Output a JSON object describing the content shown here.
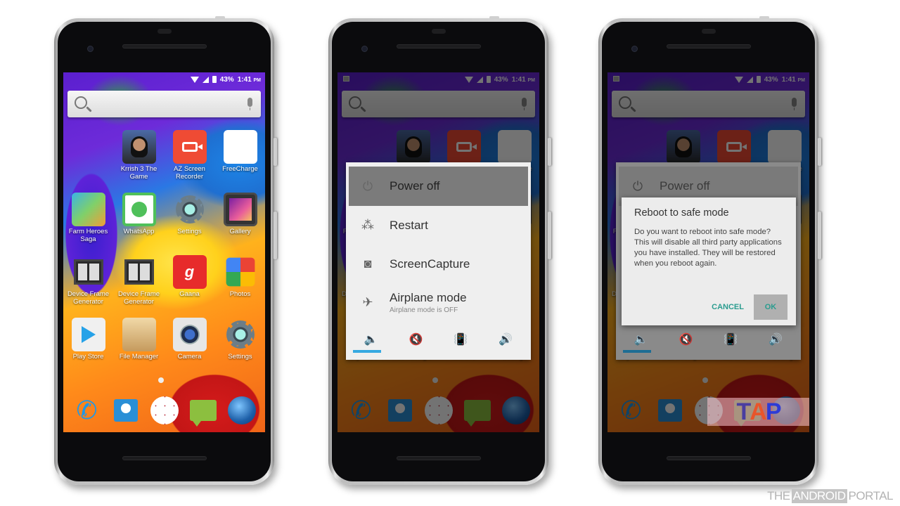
{
  "status_bar": {
    "battery": "43%",
    "time": "1:41",
    "ampm": "PM"
  },
  "search": {
    "icon": "search-icon",
    "mic_icon": "mic-icon"
  },
  "apps": [
    {
      "label": "",
      "icon": "empty"
    },
    {
      "label": "Krrish 3 The Game",
      "icon": "krrish-icon"
    },
    {
      "label": "AZ Screen Recorder",
      "icon": "video-camera-icon"
    },
    {
      "label": "FreeCharge",
      "icon": "lightning-icon"
    },
    {
      "label": "Farm Heroes Saga",
      "icon": "farm-heroes-icon"
    },
    {
      "label": "WhatsApp",
      "icon": "whatsapp-icon"
    },
    {
      "label": "Settings",
      "icon": "gear-icon"
    },
    {
      "label": "Gallery",
      "icon": "gallery-icon"
    },
    {
      "label": "Device Frame Generator",
      "icon": "device-frame-icon"
    },
    {
      "label": "Device Frame Generator",
      "icon": "device-frame-icon"
    },
    {
      "label": "Gaana",
      "icon": "gaana-icon",
      "glyph": "g"
    },
    {
      "label": "Photos",
      "icon": "pinwheel-icon"
    },
    {
      "label": "Play Store",
      "icon": "play-store-icon"
    },
    {
      "label": "File Manager",
      "icon": "file-manager-icon"
    },
    {
      "label": "Camera",
      "icon": "camera-icon"
    },
    {
      "label": "Settings",
      "icon": "gear-icon"
    }
  ],
  "dock": [
    {
      "name": "phone",
      "icon": "phone-icon",
      "glyph": "✆"
    },
    {
      "name": "contacts",
      "icon": "contacts-icon"
    },
    {
      "name": "app-drawer",
      "icon": "apps-grid-icon"
    },
    {
      "name": "messaging",
      "icon": "message-icon"
    },
    {
      "name": "browser",
      "icon": "globe-icon"
    }
  ],
  "power_menu": {
    "items": [
      {
        "label": "Power off",
        "icon": "power-icon",
        "glyph": "⏻",
        "highlighted": true
      },
      {
        "label": "Restart",
        "icon": "restart-icon",
        "glyph": "⁂"
      },
      {
        "label": "ScreenCapture",
        "icon": "camera-icon",
        "glyph": "◙"
      },
      {
        "label": "Airplane mode",
        "sublabel": "Airplane mode is OFF",
        "icon": "airplane-icon",
        "glyph": "✈"
      }
    ],
    "sound_modes": [
      {
        "name": "sound-on",
        "icon": "speaker-icon",
        "glyph": "🔈",
        "selected": true
      },
      {
        "name": "mute",
        "icon": "speaker-mute-icon",
        "glyph": "🔇"
      },
      {
        "name": "vibrate",
        "icon": "vibrate-icon",
        "glyph": "📳"
      },
      {
        "name": "sound-loud",
        "icon": "speaker-loud-icon",
        "glyph": "🔊"
      }
    ],
    "accent": "#36a9e1"
  },
  "safe_mode_dialog": {
    "title": "Reboot to safe mode",
    "body": "Do you want to reboot into safe mode? This will disable all third party applications you have installed. They will be restored when you reboot again.",
    "cancel": "CANCEL",
    "ok": "OK",
    "accent": "#2a9c8f"
  },
  "overlay_logo": {
    "letters": [
      "T",
      "A",
      "P"
    ]
  },
  "watermark": {
    "prefix": "THE",
    "highlight": "ANDROID",
    "suffix": "PORTAL"
  }
}
